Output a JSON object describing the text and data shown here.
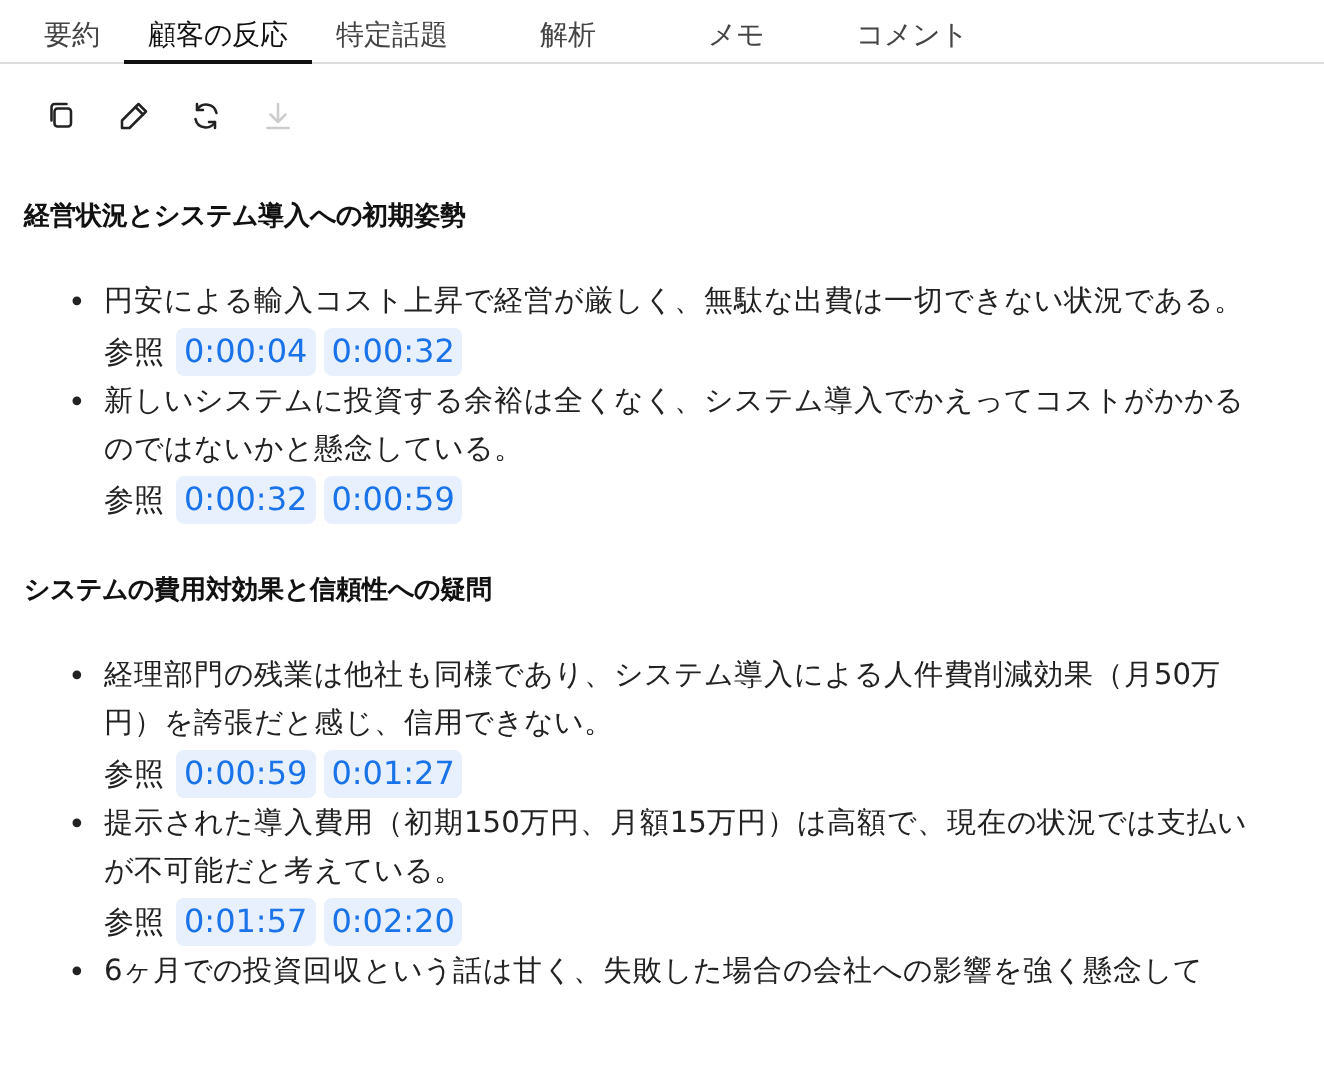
{
  "tabs": [
    {
      "label": "要約",
      "selected": false
    },
    {
      "label": "顧客の反応",
      "selected": true
    },
    {
      "label": "特定話題",
      "selected": false
    },
    {
      "label": "解析",
      "selected": false
    },
    {
      "label": "メモ",
      "selected": false
    },
    {
      "label": "コメント",
      "selected": false
    }
  ],
  "toolbar": [
    {
      "kind": "copy",
      "disabled": false
    },
    {
      "kind": "edit",
      "disabled": false
    },
    {
      "kind": "refresh",
      "disabled": false
    },
    {
      "kind": "download",
      "disabled": true
    }
  ],
  "sections": [
    {
      "heading": "経営状況とシステム導入への初期姿勢",
      "items": [
        {
          "marker": "•",
          "text": "円安による輸入コスト上昇で経営が厳しく、無駄な出費は一切できない状況である。",
          "ref_label": "参照",
          "refs": [
            "0:00:04",
            "0:00:32"
          ]
        },
        {
          "marker": "•",
          "text": "新しいシステムに投資する余裕は全くなく、システム導入でかえってコストがかかるのではないかと懸念している。",
          "ref_label": "参照",
          "refs": [
            "0:00:32",
            "0:00:59"
          ]
        }
      ]
    },
    {
      "heading": "システムの費用対効果と信頼性への疑問",
      "items": [
        {
          "marker": "•",
          "text": "経理部門の残業は他社も同様であり、システム導入による人件費削減効果（月50万円）を誇張だと感じ、信用できない。",
          "ref_label": "参照",
          "refs": [
            "0:00:59",
            "0:01:27"
          ]
        },
        {
          "marker": "•",
          "text": "提示された導入費用（初期150万円、月額15万円）は高額で、現在の状況では支払いが不可能だと考えている。",
          "ref_label": "参照",
          "refs": [
            "0:01:57",
            "0:02:20"
          ]
        },
        {
          "marker": "•",
          "text": "6ヶ月での投資回収という話は甘く、失敗した場合の会社への影響を強く懸念して"
        }
      ]
    }
  ]
}
